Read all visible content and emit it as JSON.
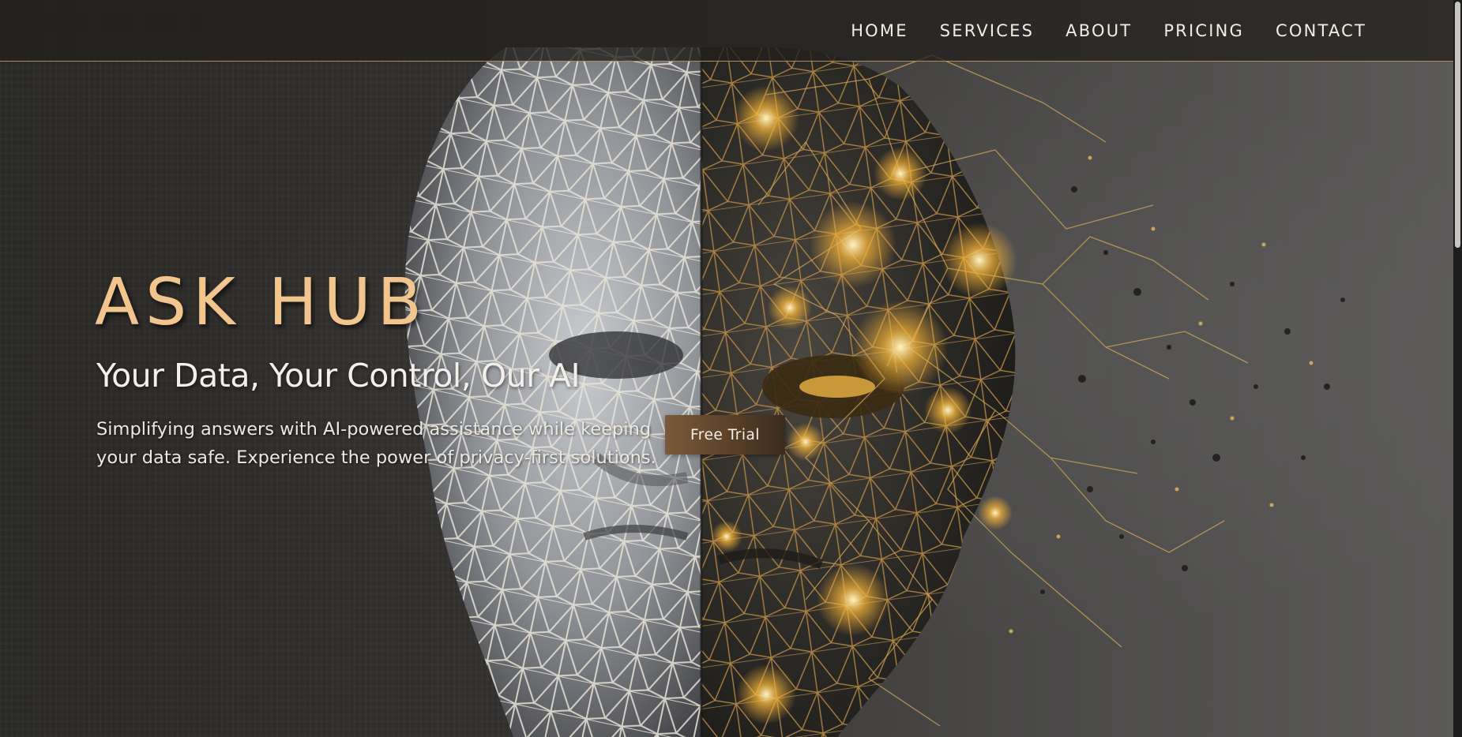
{
  "nav": {
    "items": [
      {
        "label": "HOME"
      },
      {
        "label": "SERVICES"
      },
      {
        "label": "ABOUT"
      },
      {
        "label": "PRICING"
      },
      {
        "label": "CONTACT"
      }
    ]
  },
  "hero": {
    "title": "ASK HUB",
    "subtitle": "Your Data, Your Control, Our AI",
    "description": "Simplifying answers with AI-powered assistance while keeping your data safe. Experience the power of privacy-first solutions.",
    "cta_label": "Free Trial",
    "image_icon": "ai-face-network-icon"
  },
  "colors": {
    "accent": "#f2c58e",
    "nav_border": "#b08a5b",
    "button": "#6b4d31",
    "gold_glow": "#f4b33a"
  }
}
